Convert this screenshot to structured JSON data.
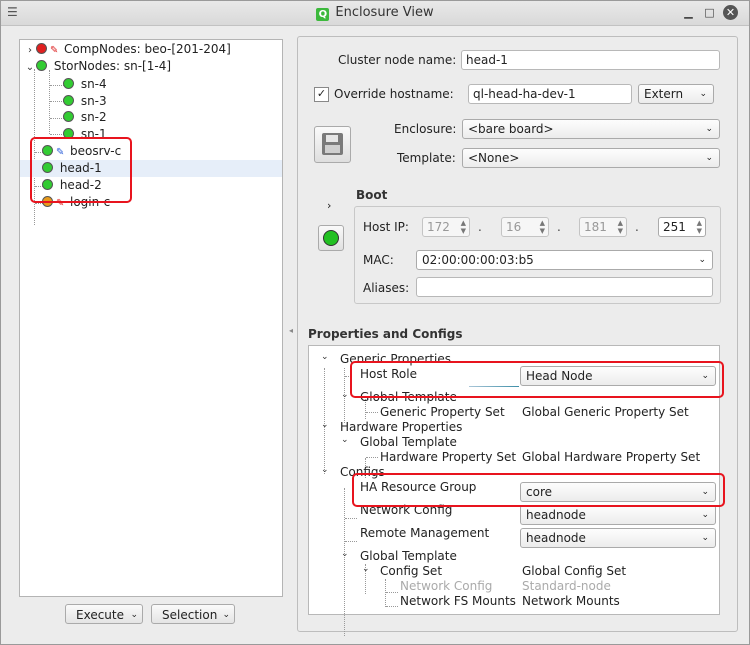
{
  "window": {
    "title": "Enclosure View"
  },
  "tree": {
    "items": [
      {
        "label": "CompNodes: beo-[201-204]",
        "status": "red",
        "expander": "›",
        "icon": "wrench-red"
      },
      {
        "label": "StorNodes: sn-[1-4]",
        "status": "green",
        "expander": "⌄"
      },
      {
        "label": "sn-4",
        "status": "green"
      },
      {
        "label": "sn-3",
        "status": "green"
      },
      {
        "label": "sn-2",
        "status": "green"
      },
      {
        "label": "sn-1",
        "status": "green"
      },
      {
        "label": "beosrv-c",
        "status": "green",
        "icon": "wrench-blue"
      },
      {
        "label": "head-1",
        "status": "green",
        "selected": true
      },
      {
        "label": "head-2",
        "status": "green"
      },
      {
        "label": "login-c",
        "status": "orange",
        "icon": "wrench-red"
      }
    ]
  },
  "buttons": {
    "execute": "Execute",
    "selection": "Selection"
  },
  "node": {
    "cluster_node_name_label": "Cluster node name:",
    "cluster_node_name": "head-1",
    "override_hostname_label": "Override hostname:",
    "override_checked": "✓",
    "hostname": "ql-head-ha-dev-1",
    "hostname_type": "Extern",
    "enclosure_label": "Enclosure:",
    "enclosure": "<bare board>",
    "template_label": "Template:",
    "template": "<None>"
  },
  "boot": {
    "title": "Boot",
    "host_ip_label": "Host IP:",
    "ip": [
      "172",
      "16",
      "181",
      "251"
    ],
    "mac_label": "MAC:",
    "mac": "02:00:00:00:03:b5",
    "aliases_label": "Aliases:",
    "aliases": ""
  },
  "properties": {
    "title": "Properties and Configs",
    "generic_properties": "Generic Properties",
    "host_role_label": "Host Role",
    "host_role": "Head Node",
    "global_template": "Global Template",
    "generic_property_set": "Generic Property Set",
    "global_generic_property_set": "Global Generic Property Set",
    "hardware_properties": "Hardware Properties",
    "hardware_property_set": "Hardware Property Set",
    "global_hardware_property_set": "Global Hardware Property Set",
    "configs": "Configs",
    "ha_resource_group_label": "HA Resource Group",
    "ha_resource_group": "core",
    "network_config_label": "Network Config",
    "network_config": "headnode",
    "remote_management_label": "Remote Management",
    "remote_management": "headnode",
    "config_set": "Config Set",
    "global_config_set": "Global Config Set",
    "network_config_sub": "Network Config",
    "standard_node": "Standard-node",
    "network_fs_mounts_label": "Network FS Mounts",
    "network_mounts": "Network Mounts"
  }
}
